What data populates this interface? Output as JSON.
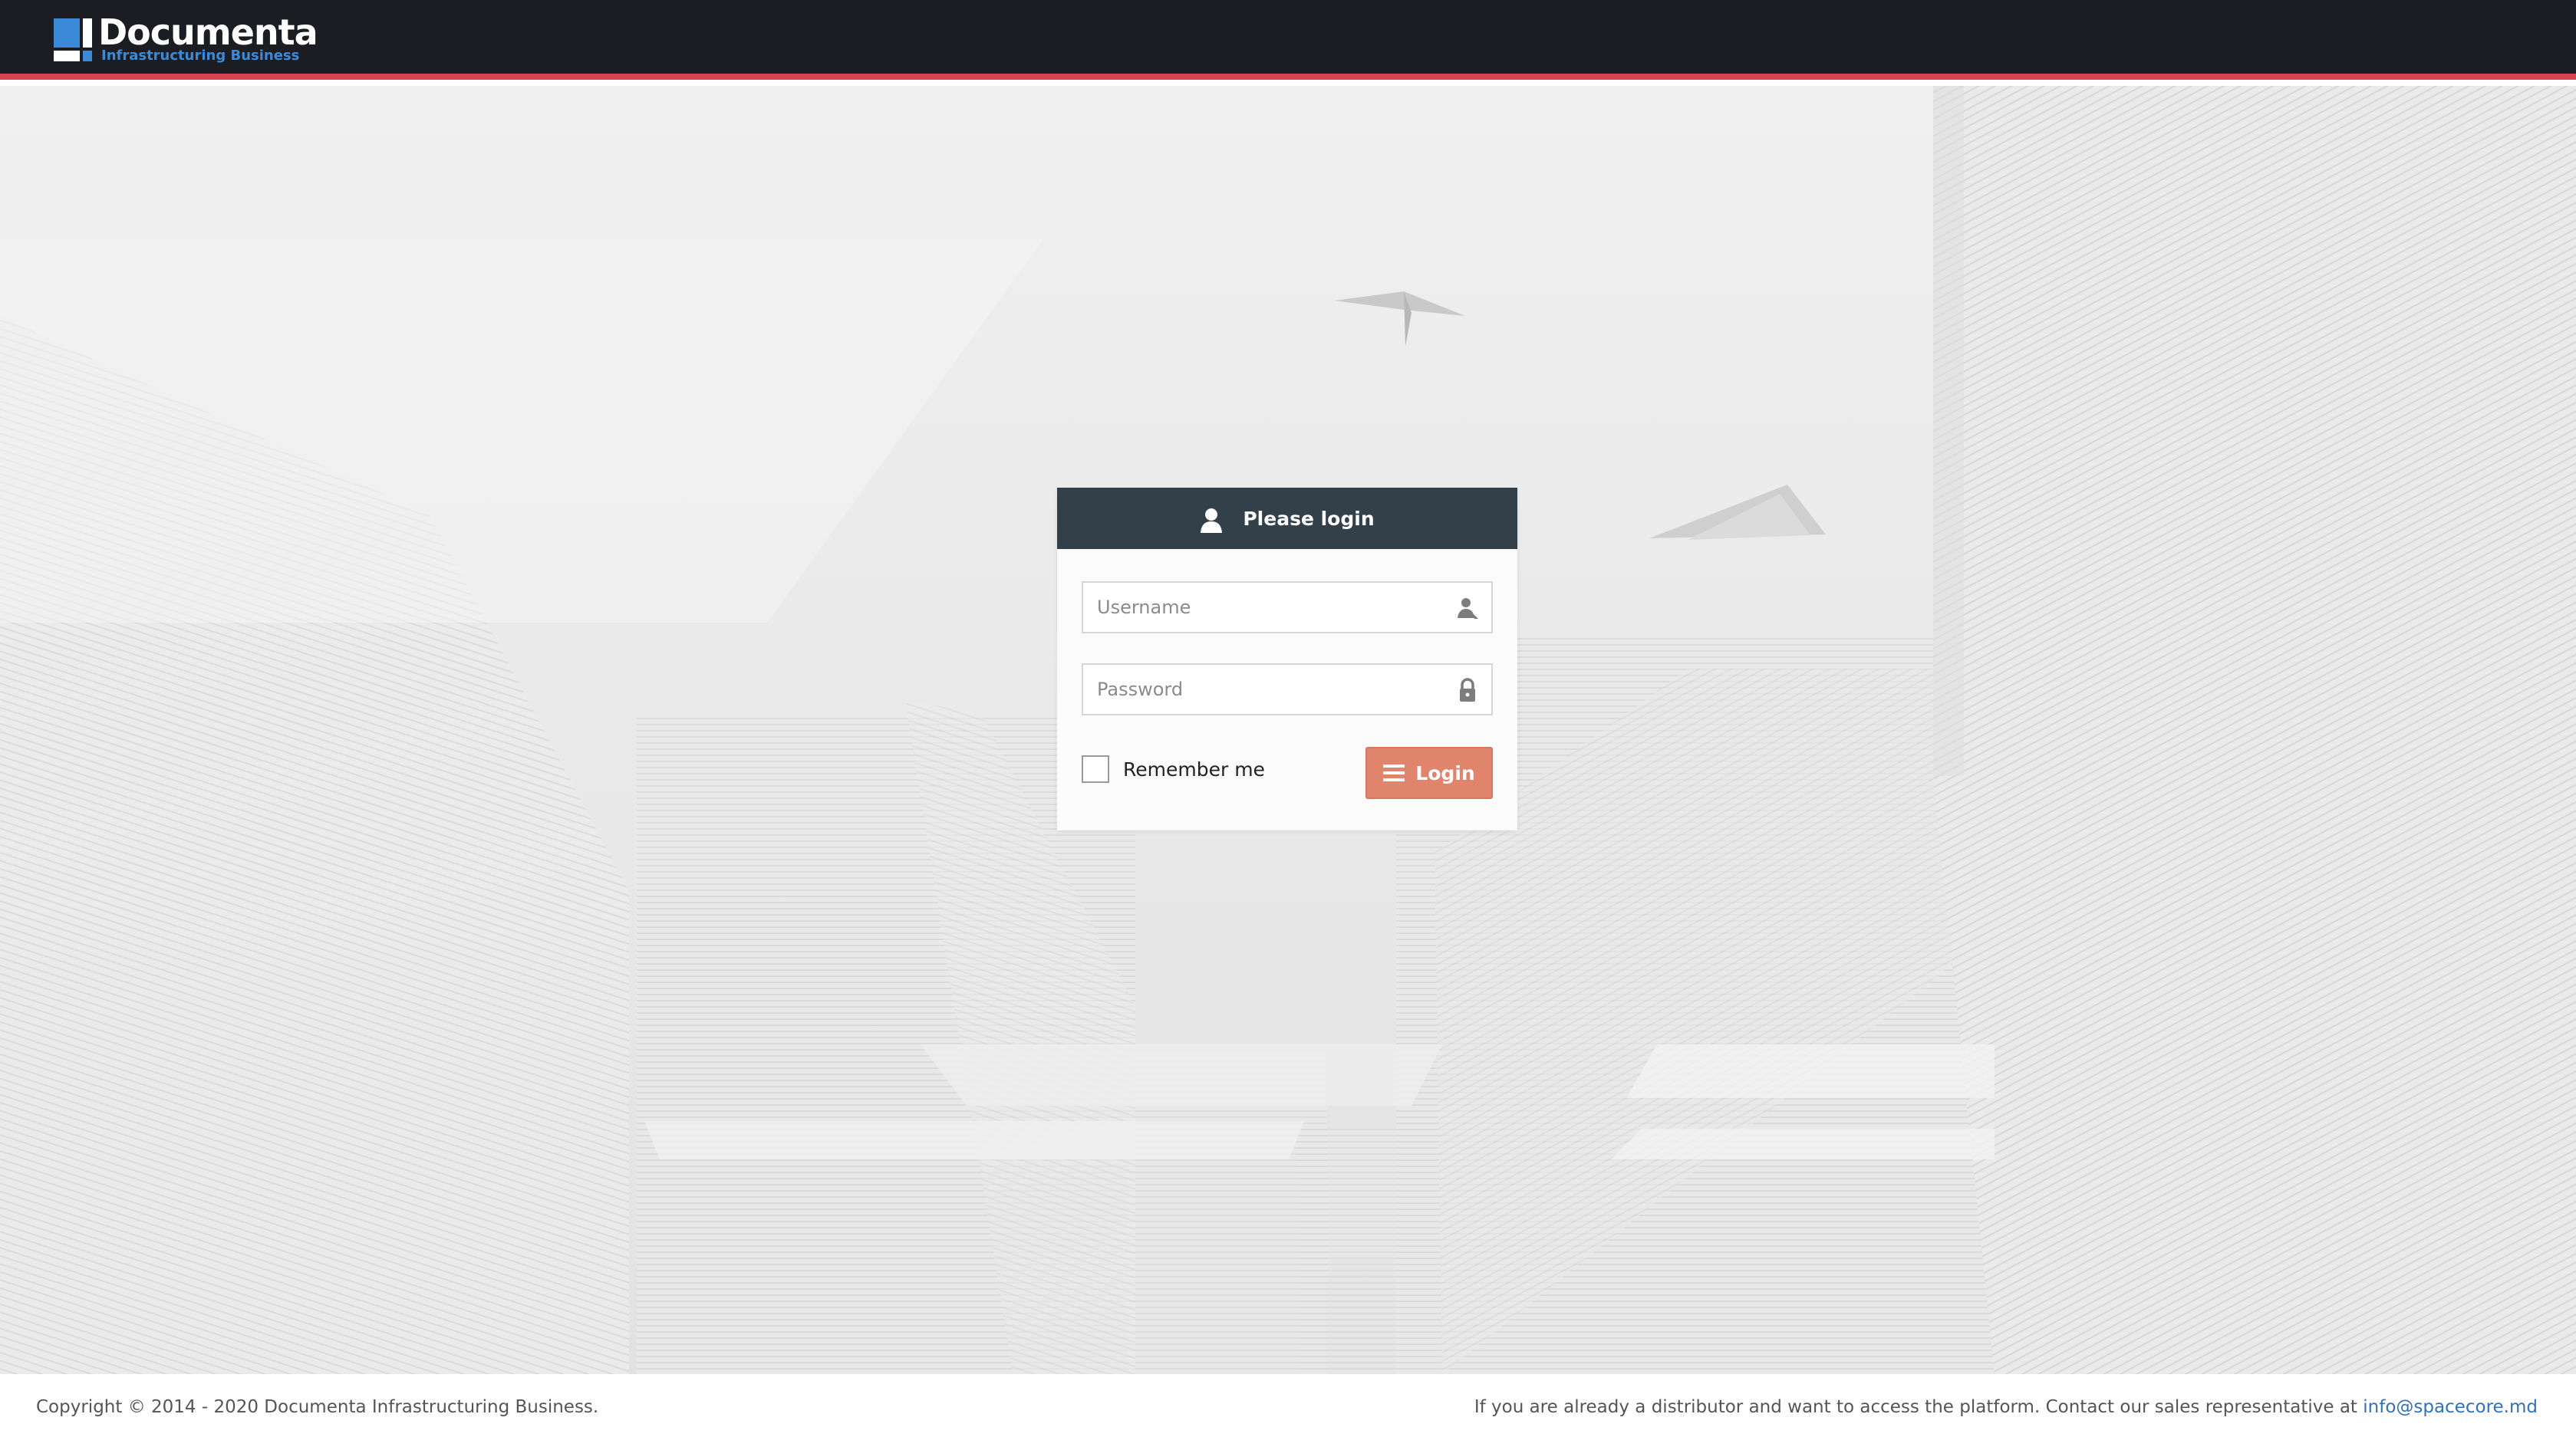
{
  "header": {
    "logo_name": "Documenta",
    "logo_tagline": "Infrastructuring Business",
    "accent_color": "#d9434f",
    "background_color": "#1b1d22"
  },
  "login": {
    "title": "Please login",
    "username_placeholder": "Username",
    "password_placeholder": "Password",
    "remember_label": "Remember me",
    "remember_checked": false,
    "button_label": "Login",
    "header_color": "#334049",
    "button_color": "#e0856c",
    "icons": {
      "title": "user-icon",
      "username": "user-field-icon",
      "password": "lock-icon",
      "button": "menu-icon"
    }
  },
  "footer": {
    "copyright": "Copyright © 2014 - 2020 Documenta Infrastructuring Business.",
    "contact_text": "If you are already a distributor and want to access the platform. Contact our sales representative at ",
    "contact_email": "info@spacecore.md",
    "link_color": "#2f72b7"
  }
}
